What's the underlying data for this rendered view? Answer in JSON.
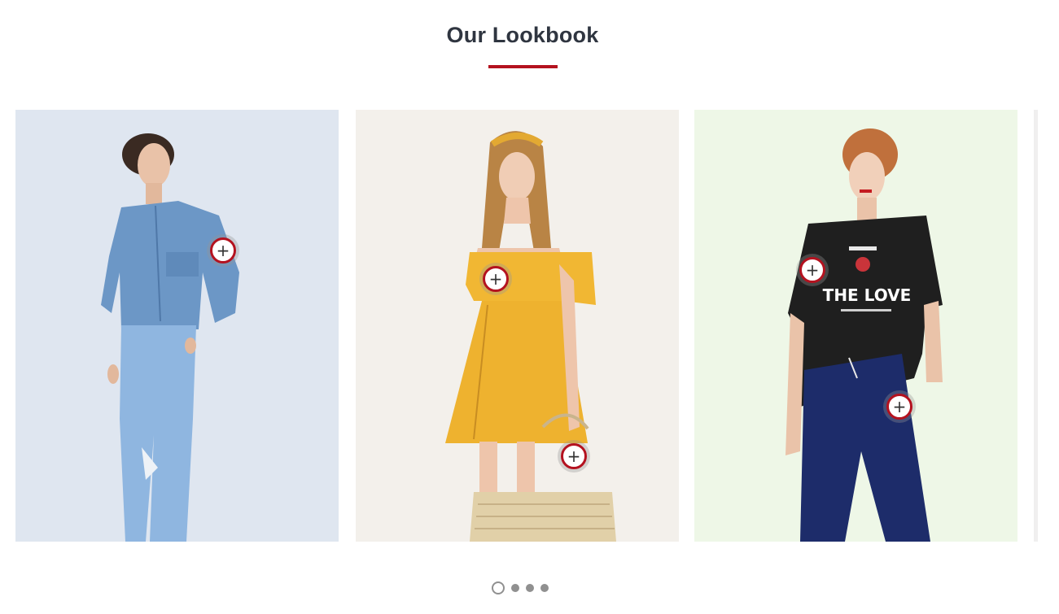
{
  "section": {
    "title": "Our Lookbook",
    "accent_color": "#b4121f"
  },
  "cards": [
    {
      "background": "#dfe6f0",
      "hotspots": [
        {
          "icon": "plus-icon",
          "glyph": "+"
        }
      ]
    },
    {
      "background": "#f3f0eb",
      "hotspots": [
        {
          "icon": "plus-icon",
          "glyph": "+"
        },
        {
          "icon": "plus-icon",
          "glyph": "+"
        }
      ]
    },
    {
      "background": "#eef7e7",
      "hotspots": [
        {
          "icon": "plus-icon",
          "glyph": "+"
        },
        {
          "icon": "plus-icon",
          "glyph": "+"
        }
      ]
    }
  ],
  "pagination": {
    "total": 4,
    "active_index": 0
  }
}
